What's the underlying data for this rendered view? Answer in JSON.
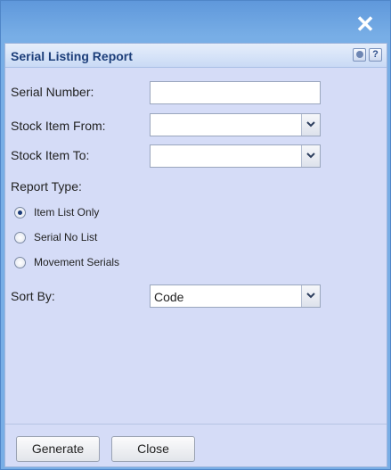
{
  "window": {
    "close_glyph": "✕"
  },
  "panel": {
    "title": "Serial Listing Report",
    "settings_icon": "gear-icon",
    "help_label": "?"
  },
  "form": {
    "serial_number_label": "Serial Number:",
    "serial_number_value": "",
    "stock_from_label": "Stock Item From:",
    "stock_from_value": "",
    "stock_to_label": "Stock Item To:",
    "stock_to_value": "",
    "report_type_label": "Report Type:",
    "report_types": [
      {
        "label": "Item List Only",
        "checked": true
      },
      {
        "label": "Serial No List",
        "checked": false
      },
      {
        "label": "Movement Serials",
        "checked": false
      }
    ],
    "sort_by_label": "Sort By:",
    "sort_by_value": "Code"
  },
  "footer": {
    "generate_label": "Generate",
    "close_label": "Close"
  }
}
